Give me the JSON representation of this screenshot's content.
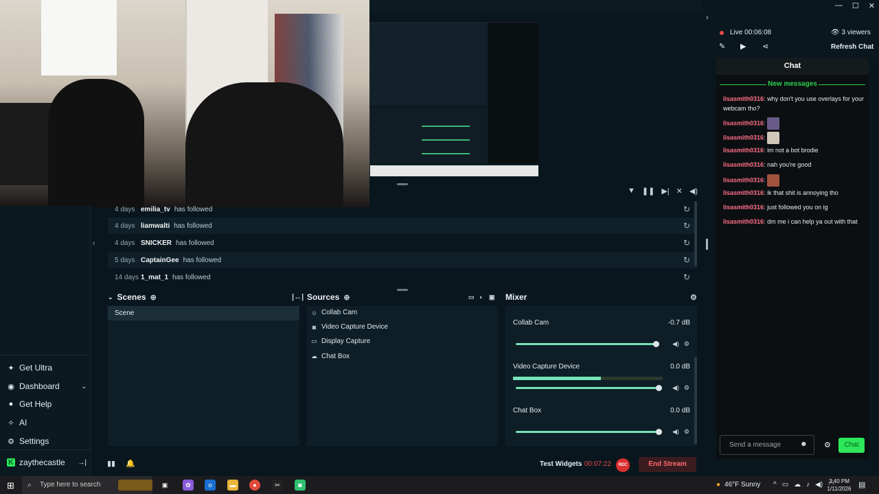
{
  "nav": {
    "items": [
      {
        "label": "Get Ultra",
        "icon": "ultra-icon"
      },
      {
        "label": "Dashboard",
        "icon": "dashboard-icon"
      },
      {
        "label": "Get Help",
        "icon": "help-icon"
      },
      {
        "label": "AI",
        "icon": "ai-icon"
      },
      {
        "label": "Settings",
        "icon": "gear-icon"
      }
    ],
    "user": "zaythecastle"
  },
  "feed": {
    "rows": [
      {
        "age": "4 days",
        "user": "emilia_tv",
        "action": "has followed"
      },
      {
        "age": "4 days",
        "user": "liamwalti",
        "action": "has followed"
      },
      {
        "age": "4 days",
        "user": "SNICKER",
        "action": "has followed"
      },
      {
        "age": "5 days",
        "user": "CaptainGee",
        "action": "has followed"
      },
      {
        "age": "14 days",
        "user": "1_mat_1",
        "action": "has followed"
      }
    ]
  },
  "scenes": {
    "title": "Scenes",
    "items": [
      "Scene"
    ]
  },
  "sources": {
    "title": "Sources",
    "items": [
      {
        "label": "Collab Cam",
        "icon": "collab-cam-icon"
      },
      {
        "label": "Video Capture Device",
        "icon": "webcam-icon"
      },
      {
        "label": "Display Capture",
        "icon": "monitor-icon"
      },
      {
        "label": "Chat Box",
        "icon": "chat-icon"
      }
    ]
  },
  "mixer": {
    "title": "Mixer",
    "channels": [
      {
        "label": "Collab Cam",
        "db": "-0.7 dB",
        "level": 0.94
      },
      {
        "label": "Video Capture Device",
        "db": "0.0 dB",
        "level": 0.96
      },
      {
        "label": "Chat Box",
        "db": "0.0 dB",
        "level": 0.96
      }
    ]
  },
  "bottom": {
    "test_widgets": "Test Widgets",
    "timer": "00:07:22",
    "rec": "REC",
    "end_stream": "End Stream"
  },
  "live": {
    "label": "Live",
    "time": "00:06:08",
    "viewers": "3 viewers",
    "refresh": "Refresh Chat"
  },
  "chat": {
    "title": "Chat",
    "new_messages": "New messages",
    "messages": [
      {
        "user": "lisasmith0316",
        "text": "why don't you use overlays for your webcam tho?"
      },
      {
        "user": "lisasmith0316",
        "text": ""
      },
      {
        "user": "lisasmith0316",
        "text": ""
      },
      {
        "user": "lisasmith0316",
        "text": "im not a bot brodie"
      },
      {
        "user": "lisasmith0316",
        "text": "nah you're good"
      },
      {
        "user": "lisasmith0316",
        "text": ""
      },
      {
        "user": "lisasmith0316",
        "text": "ik that shit is annoying tho"
      },
      {
        "user": "lisasmith0316",
        "text": "just followed you on ig"
      },
      {
        "user": "lisasmith0316",
        "text": "dm me i can help ya out with that"
      }
    ],
    "input_placeholder": "Send a message",
    "send": "Chat"
  },
  "taskbar": {
    "search_placeholder": "Type here to search",
    "weather": "46°F  Sunny",
    "time": "3:40 PM",
    "date": "1/11/2026"
  },
  "colors": {
    "accent": "#76e4b8",
    "live": "#e84a4a",
    "chat_user": "#ff6f8a",
    "chat_button": "#2ee65a"
  }
}
